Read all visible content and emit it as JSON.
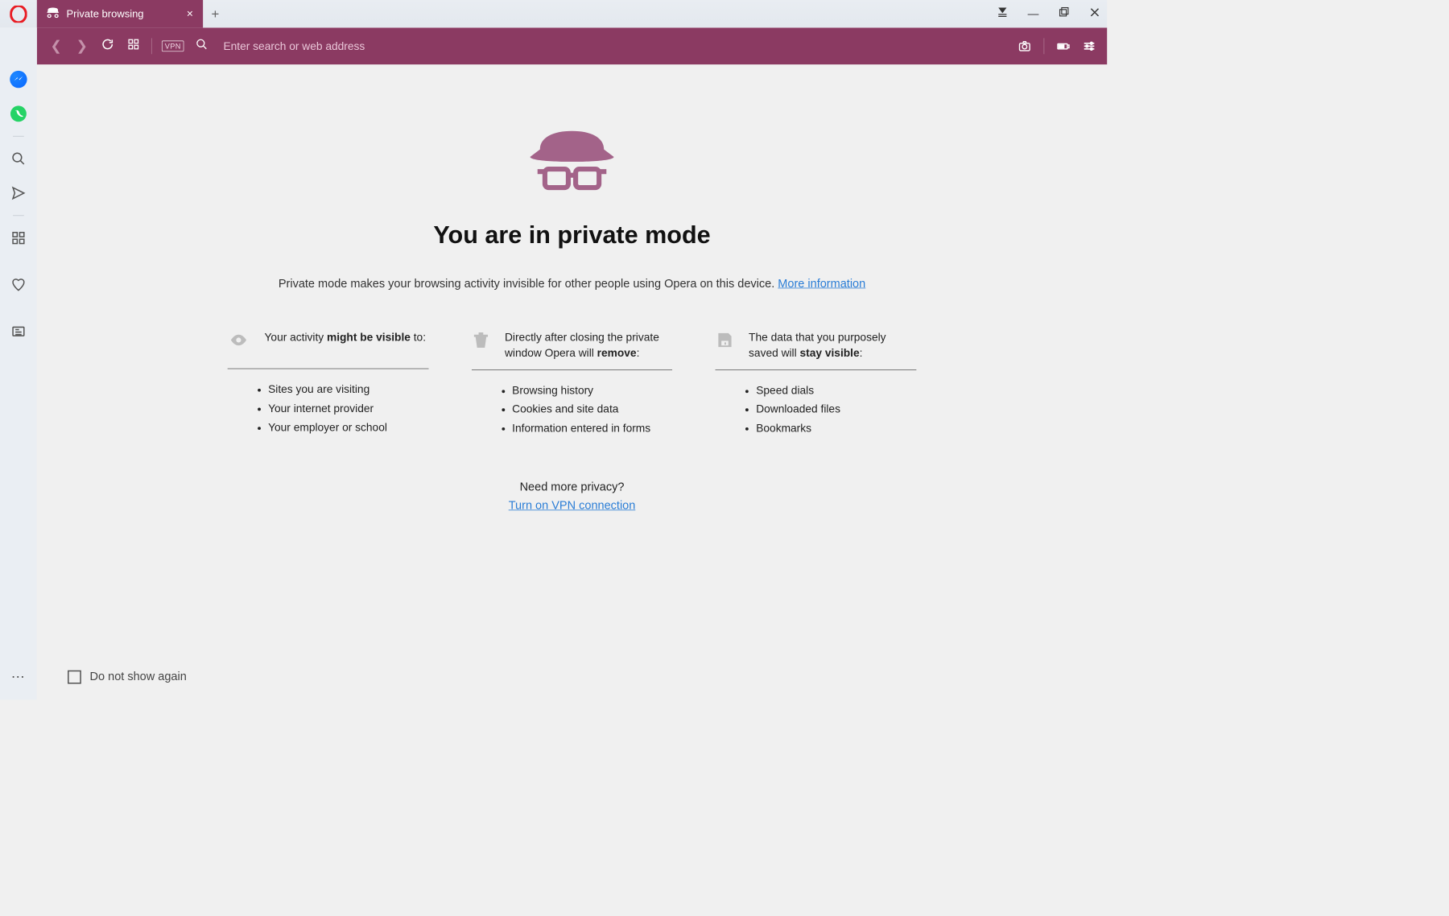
{
  "tab": {
    "title": "Private browsing"
  },
  "address": {
    "vpn_label": "VPN",
    "placeholder": "Enter search or web address"
  },
  "page": {
    "headline": "You are in private mode",
    "sub_pre": "Private mode makes your browsing activity invisible for other people using Opera on this device. ",
    "sub_link": "More information",
    "vpn_q": "Need more privacy?",
    "vpn_link": "Turn on VPN connection",
    "dns_label": "Do not show again"
  },
  "cols": {
    "c0": {
      "t_pre": "Your activity ",
      "t_bold": "might be visible",
      "t_post": " to:",
      "i0": "Sites you are visiting",
      "i1": "Your internet provider",
      "i2": "Your employer or school"
    },
    "c1": {
      "t_pre": "Directly after closing the private window Opera will ",
      "t_bold": "remove",
      "t_post": ":",
      "i0": "Browsing history",
      "i1": "Cookies and site data",
      "i2": "Information entered in forms"
    },
    "c2": {
      "t_pre": "The data that you purposely saved will ",
      "t_bold": "stay visible",
      "t_post": ":",
      "i0": "Speed dials",
      "i1": "Downloaded files",
      "i2": "Bookmarks"
    }
  }
}
